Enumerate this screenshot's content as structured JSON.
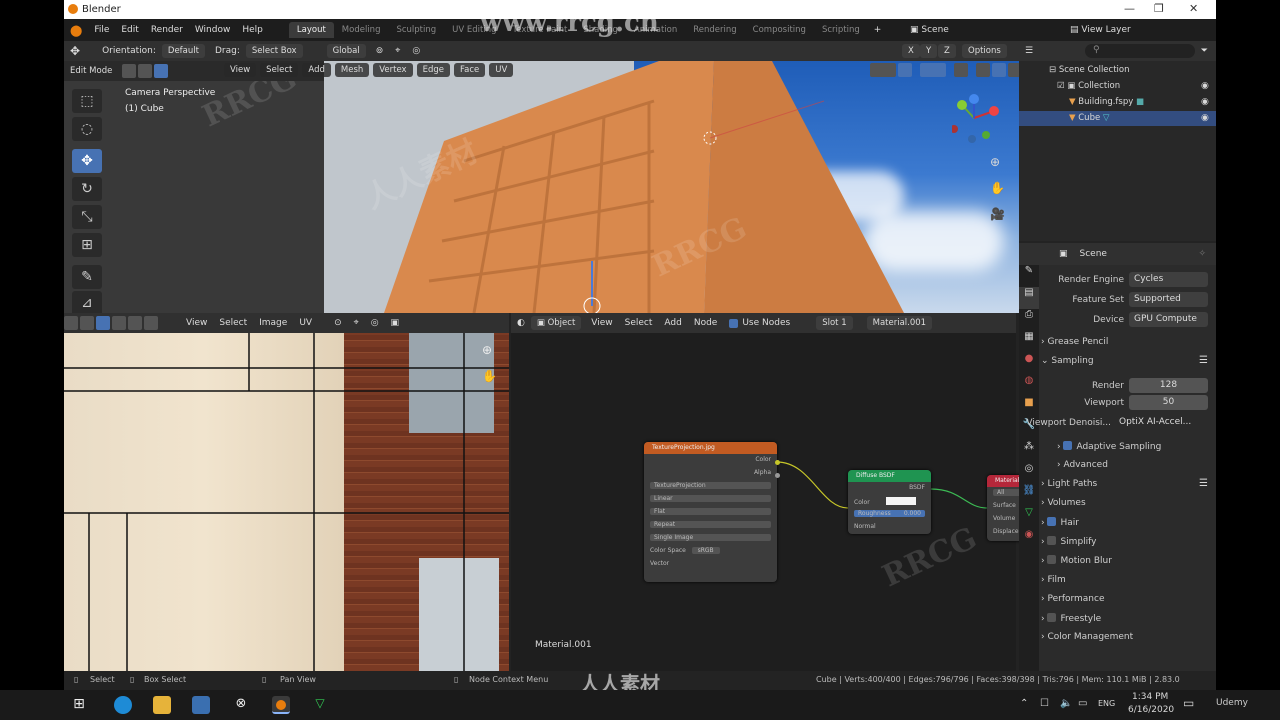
{
  "window": {
    "title": "Blender"
  },
  "menu": [
    "File",
    "Edit",
    "Render",
    "Window",
    "Help"
  ],
  "workspaces": [
    "Layout",
    "Modeling",
    "Sculpting",
    "UV Editing",
    "Texture Paint",
    "Shading",
    "Animation",
    "Rendering",
    "Compositing",
    "Scripting"
  ],
  "scene_label": "Scene",
  "view_layer": "View Layer",
  "header3d": {
    "orientation_label": "Orientation:",
    "orientation_value": "Default",
    "drag_label": "Drag:",
    "drag_value": "Select Box",
    "transform": "Global",
    "options": "Options"
  },
  "header3d_axes": [
    "X",
    "Y",
    "Z"
  ],
  "edit_header": {
    "mode": "Edit Mode",
    "items": [
      "View",
      "Select",
      "Add",
      "Mesh",
      "Vertex",
      "Edge",
      "Face",
      "UV"
    ]
  },
  "viewport": {
    "camera": "Camera Perspective",
    "object": "(1) Cube"
  },
  "uv_header": [
    "View",
    "Select",
    "Image",
    "UV"
  ],
  "node_header": {
    "object": "Object",
    "items": [
      "View",
      "Select",
      "Add",
      "Node"
    ],
    "use_nodes": "Use Nodes",
    "slot": "Slot 1",
    "material": "Material.001"
  },
  "node_footer": "Material.001",
  "nodes": {
    "tex": {
      "title": "TextureProjection.jpg",
      "outputs": [
        "Color",
        "Alpha"
      ],
      "image": "TextureProjection",
      "fields": [
        "Linear",
        "Flat",
        "Repeat",
        "Single Image"
      ],
      "cs_label": "Color Space",
      "cs_value": "sRGB",
      "input": "Vector"
    },
    "bsdf": {
      "title": "Diffuse BSDF",
      "out": "BSDF",
      "in_color": "Color",
      "rough_label": "Roughness",
      "rough_value": "0.000",
      "normal": "Normal"
    },
    "out": {
      "title": "Material Output",
      "target": "All",
      "inputs": [
        "Surface",
        "Volume",
        "Displacement"
      ]
    }
  },
  "outliner": {
    "root": "Scene Collection",
    "items": [
      {
        "label": "Collection"
      },
      {
        "label": "Building.fspy"
      },
      {
        "label": "Cube"
      }
    ]
  },
  "props": {
    "context": "Scene",
    "rows": [
      {
        "label": "Render Engine",
        "value": "Cycles"
      },
      {
        "label": "Feature Set",
        "value": "Supported"
      },
      {
        "label": "Device",
        "value": "GPU Compute"
      }
    ],
    "grease": "Grease Pencil",
    "sampling": "Sampling",
    "render_label": "Render",
    "render_value": "128",
    "viewport_label": "Viewport",
    "viewport_value": "50",
    "denoise_label": "Viewport Denoisi...",
    "denoise_value": "OptiX AI-Accel...",
    "adaptive": "Adaptive Sampling",
    "advanced": "Advanced",
    "sections": [
      "Light Paths",
      "Volumes",
      "Hair",
      "Simplify",
      "Motion Blur",
      "Film",
      "Performance",
      "Freestyle",
      "Color Management"
    ]
  },
  "status": {
    "select": "Select",
    "box": "Box Select",
    "pan": "Pan View",
    "ctx": "Node Context Menu",
    "stats": "Cube | Verts:400/400 | Edges:796/796 | Faces:398/398 | Tris:796 | Mem: 110.1 MiB | 2.83.0"
  },
  "taskbar": {
    "lang": "ENG",
    "time": "1:34 PM",
    "date": "6/16/2020"
  },
  "watermarks": {
    "site": "www.rrcg.cn",
    "brand": "RRCG",
    "cn": "人人素材",
    "udemy": "Udemy"
  },
  "colors": {
    "accent": "#4772b3",
    "orange": "#e87d0d",
    "building": "#d8874a"
  }
}
